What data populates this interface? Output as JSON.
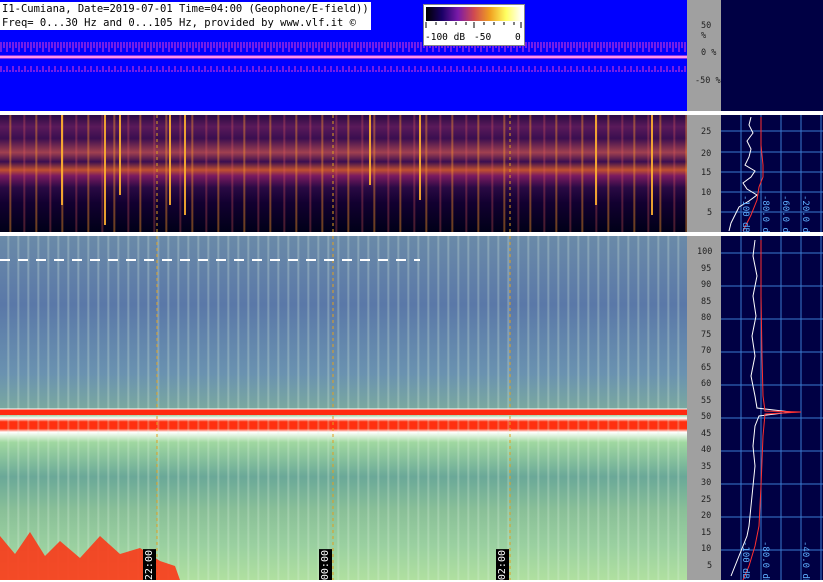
{
  "header": {
    "line1": "I1-Cumiana, Date=2019-07-01 Time=04:00 (Geophone/E-field))",
    "line2": "Freq= 0...30 Hz and 0...105 Hz, provided by www.vlf.it ©"
  },
  "colorbar": {
    "labels": [
      "-100 dB",
      "-50",
      "0"
    ]
  },
  "waveform_axis": [
    "50 %",
    "0 %",
    "-50 %"
  ],
  "upper_freq_axis": [
    "25",
    "20",
    "15",
    "10",
    "5"
  ],
  "lower_freq_axis": [
    "100",
    "95",
    "90",
    "85",
    "80",
    "75",
    "70",
    "65",
    "60",
    "55",
    "50",
    "45",
    "40",
    "35",
    "30",
    "25",
    "20",
    "15",
    "10",
    "5"
  ],
  "upper_spectrum_labels": [
    "-100 dB",
    "-80.0 dB",
    "-60.0 dB",
    "-40.0 dB",
    "-20.0 dB"
  ],
  "lower_spectrum_labels": [
    "-100 dB",
    "-80.0 dB",
    "-60.0 dB",
    "-40.0 dB",
    "-20.0 dB"
  ],
  "time_markers": [
    "22:00",
    "00:00",
    "02:00"
  ],
  "colors": {
    "waveform_bg": "#0000ff",
    "waveform_trace": "#ff44cc",
    "spectrum_panel_bg": "#000044",
    "axis_bg": "#a0a0a0",
    "marker_line": "#e0a020"
  }
}
